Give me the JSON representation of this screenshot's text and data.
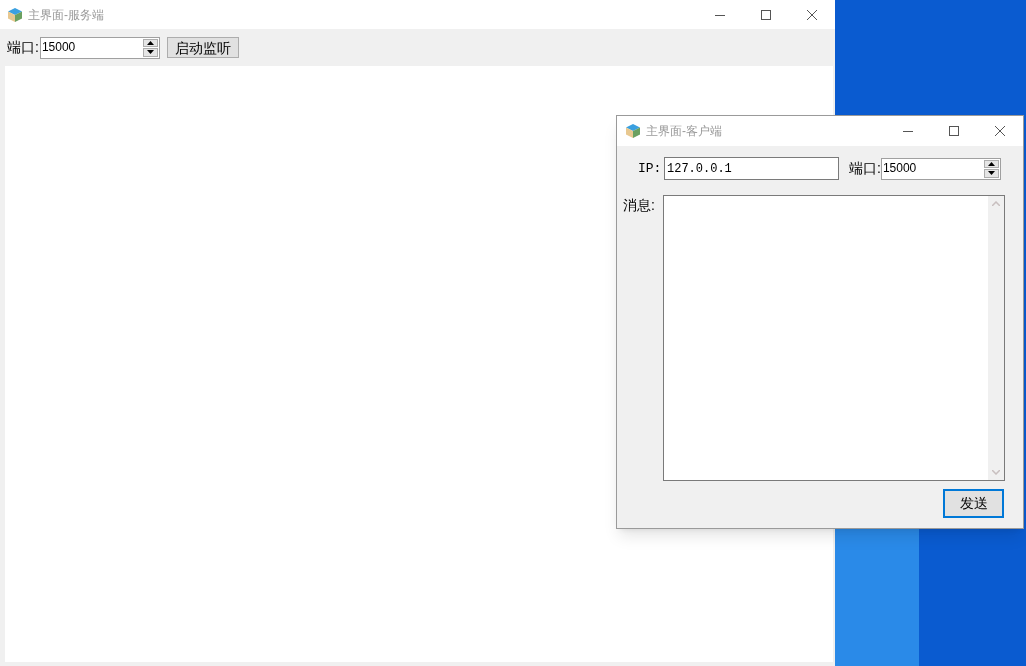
{
  "server_window": {
    "title": "主界面-服务端",
    "port_label": "端口:",
    "port_value": "15000",
    "start_button": "启动监听"
  },
  "client_window": {
    "title": "主界面-客户端",
    "ip_label": "IP:",
    "ip_value": "127.0.0.1",
    "port_label": "端口:",
    "port_value": "15000",
    "message_label": "消息:",
    "send_button": {
      "label": "发送",
      "focused": true
    }
  }
}
